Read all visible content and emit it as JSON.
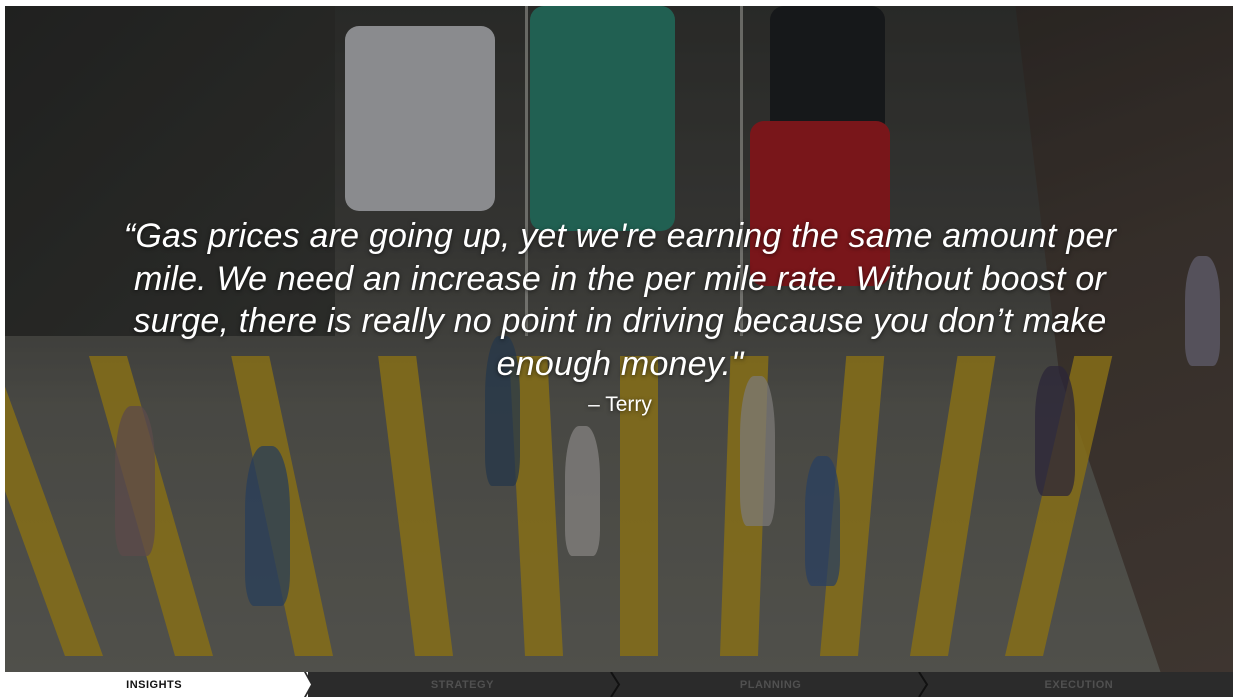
{
  "quote": {
    "text": "“Gas prices are going up, yet we're earning the same amount per mile. We need an increase in the per mile rate. Without boost or surge, there is really no point in driving because you don’t make enough money.\"",
    "author": "– Terry"
  },
  "progress": {
    "steps": [
      {
        "label": "INSIGHTS",
        "active": true
      },
      {
        "label": "STRATEGY",
        "active": false
      },
      {
        "label": "PLANNING",
        "active": false
      },
      {
        "label": "EXECUTION",
        "active": false
      }
    ]
  },
  "colors": {
    "active_step_bg": "#ffffff",
    "inactive_step_bg": "#2b2b2b",
    "crosswalk_yellow": "#c9a520",
    "quote_text": "#ffffff"
  }
}
